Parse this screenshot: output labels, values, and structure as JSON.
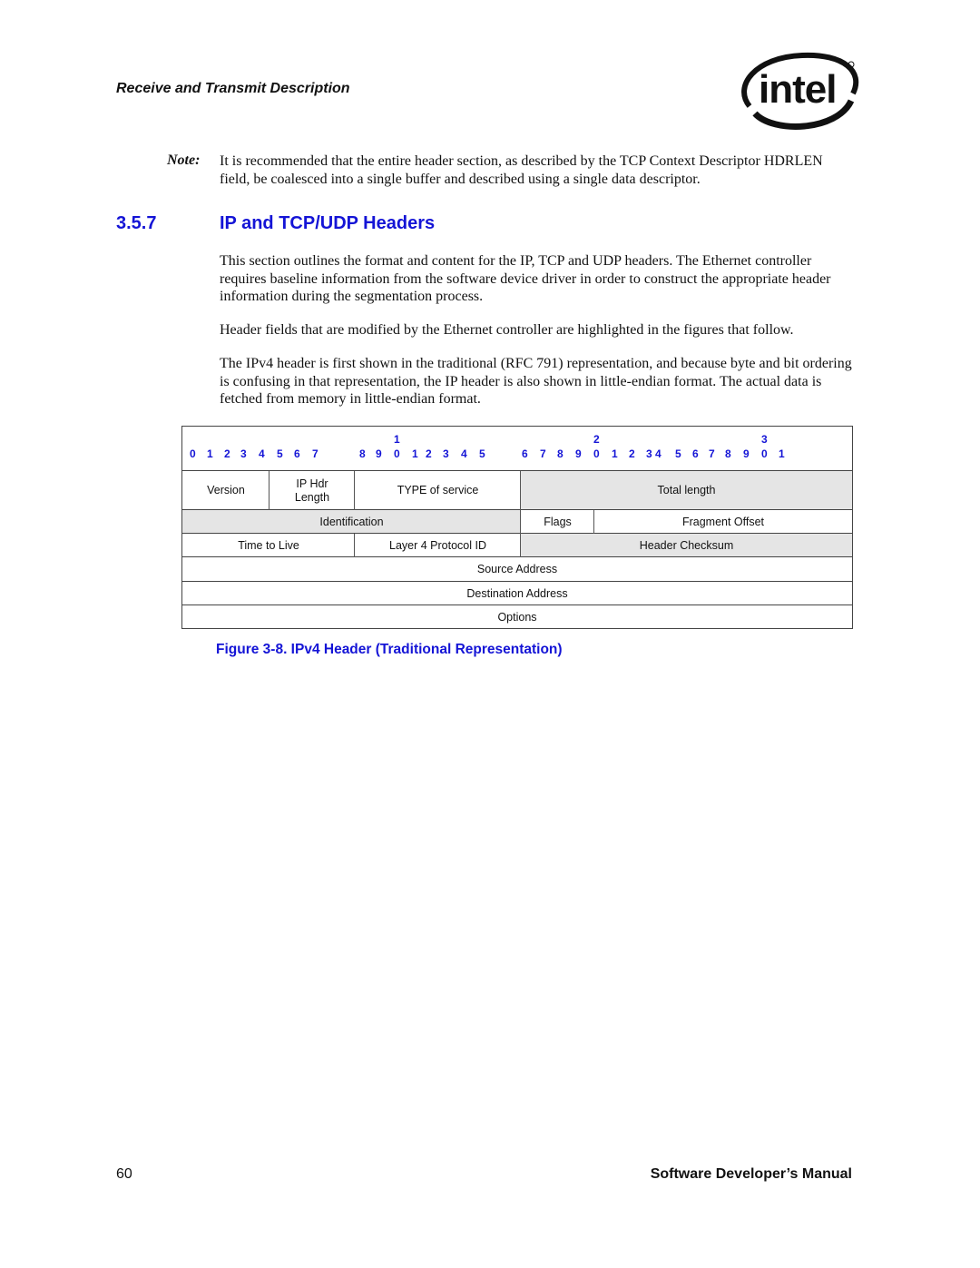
{
  "header": {
    "running_head": "Receive and Transmit Description",
    "logo": {
      "icon": "intel-logo-icon",
      "text": "intel"
    }
  },
  "note": {
    "label": "Note:",
    "text": "It is recommended that the entire header section, as described by the TCP Context Descriptor HDRLEN field, be coalesced into a single buffer and described using a single data descriptor."
  },
  "section": {
    "number": "3.5.7",
    "title": "IP and TCP/UDP Headers",
    "paragraphs": [
      "This section outlines the format and content for the IP, TCP and UDP headers. The Ethernet controller requires baseline information from the software device driver in order to construct the appropriate header information during the segmentation process.",
      "Header fields that are modified by the Ethernet controller are highlighted in the figures that follow.",
      "The IPv4 header is first shown in the traditional (RFC 791) representation, and because byte and bit ordering is confusing in that representation, the IP header is also shown in little-endian format. The actual data is fetched from memory in little-endian format."
    ]
  },
  "figure": {
    "caption": "Figure 3-8. IPv4 Header (Traditional Representation)",
    "bit_ruler": {
      "tens": [
        "1",
        "2",
        "3"
      ],
      "units": [
        "0",
        "1",
        "2",
        "3",
        "4",
        "5",
        "6",
        "7",
        "8",
        "9",
        "0",
        "1",
        "2",
        "3",
        "4",
        "5",
        "6",
        "7",
        "8",
        "9",
        "0",
        "1",
        "2",
        "3",
        "4",
        "5",
        "6",
        "7",
        "8",
        "9",
        "0",
        "1"
      ]
    },
    "rows": [
      [
        {
          "label": "Version",
          "highlighted": false
        },
        {
          "label": "IP Hdr Length",
          "highlighted": false
        },
        {
          "label": "TYPE of service",
          "highlighted": false
        },
        {
          "label": "Total length",
          "highlighted": true
        }
      ],
      [
        {
          "label": "Identification",
          "highlighted": true
        },
        {
          "label": "Flags",
          "highlighted": false
        },
        {
          "label": "Fragment Offset",
          "highlighted": false
        }
      ],
      [
        {
          "label": "Time to Live",
          "highlighted": false
        },
        {
          "label": "Layer 4 Protocol ID",
          "highlighted": false
        },
        {
          "label": "Header Checksum",
          "highlighted": true
        }
      ],
      [
        {
          "label": "Source Address",
          "highlighted": false
        }
      ],
      [
        {
          "label": "Destination Address",
          "highlighted": false
        }
      ],
      [
        {
          "label": "Options",
          "highlighted": false
        }
      ]
    ],
    "colors": {
      "highlight": "#e5e5e5",
      "ruler": "#1414d6"
    }
  },
  "footer": {
    "page_number": "60",
    "manual_title": "Software Developer’s Manual"
  },
  "colors": {
    "heading": "#1414d6",
    "text": "#111111"
  }
}
